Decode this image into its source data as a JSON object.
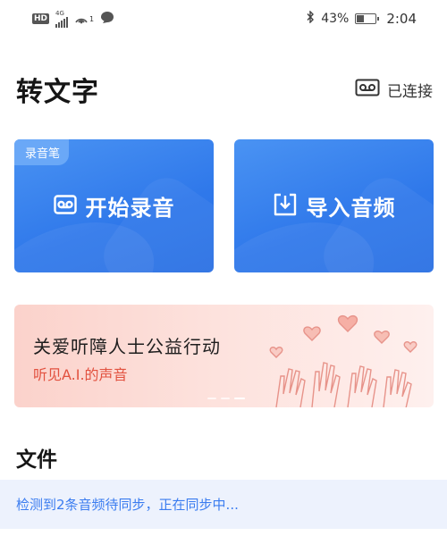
{
  "status_bar": {
    "hd": "HD",
    "network": "4G",
    "notification_count": "1",
    "battery_percent": "43%",
    "battery_level": 0.43,
    "time": "2:04",
    "icons": [
      "hd-icon",
      "signal-icon",
      "hotspot-icon",
      "chat-icon",
      "bluetooth-icon",
      "battery-icon"
    ]
  },
  "header": {
    "title": "转文字",
    "connection_label": "已连接",
    "connection_icon": "recorder-icon"
  },
  "actions": {
    "record": {
      "tag": "录音笔",
      "label": "开始录音",
      "icon": "recorder-icon"
    },
    "import": {
      "label": "导入音频",
      "icon": "import-icon"
    }
  },
  "banner": {
    "title": "关爱听障人士公益行动",
    "subtitle": "听见A.I.的声音",
    "page_count": 3,
    "active_page": 3
  },
  "files": {
    "title": "文件",
    "sync_message": "检测到2条音频待同步，正在同步中..."
  },
  "colors": {
    "card_blue": "#3a82ee",
    "sync_text": "#3a7cf0",
    "banner_accent": "#e2513f"
  }
}
